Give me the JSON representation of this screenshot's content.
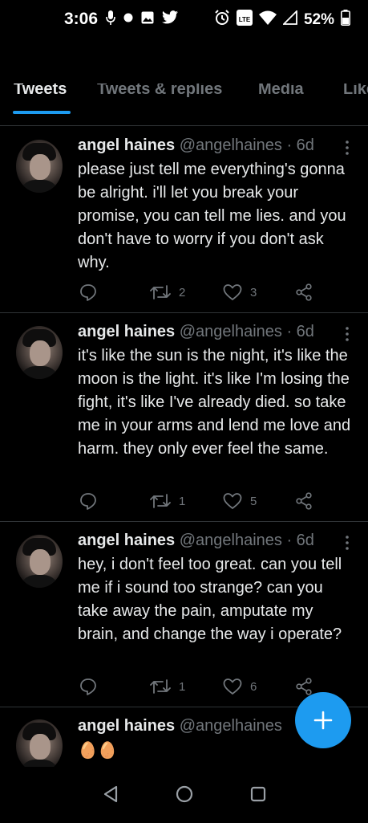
{
  "status_bar": {
    "time": "3:06",
    "battery": "52%",
    "lte_label": "LTE"
  },
  "tabs": [
    {
      "label": "Tweets",
      "active": true
    },
    {
      "label": "Tweets & replies",
      "active": false
    },
    {
      "label": "Media",
      "active": false
    },
    {
      "label": "Likes",
      "active": false
    }
  ],
  "tweets": [
    {
      "name": "angel haines",
      "handle": "@angelhaines",
      "time": "· 6d",
      "text": "please just tell me everything's gonna be alright. i'll let you break your promise, you can tell me lies. and you don't have to worry if you don't ask why.",
      "retweets": "2",
      "likes": "3"
    },
    {
      "name": "angel haines",
      "handle": "@angelhaines",
      "time": "· 6d",
      "text": "it's like the sun is the night, it's like the moon is the light. it's like I'm losing the fight, it's like I've already died. so take me in your arms and lend me love and harm. they only ever feel the same.",
      "retweets": "1",
      "likes": "5"
    },
    {
      "name": "angel haines",
      "handle": "@angelhaines",
      "time": "· 6d",
      "text": "hey, i don't feel too great. can you tell me if i sound too strange? can you take away the pain, amputate my brain, and change the way i operate?",
      "retweets": "1",
      "likes": "6"
    },
    {
      "name": "angel haines",
      "handle": "@angelhaines",
      "time": "",
      "text": "🥚🥚"
    }
  ],
  "colors": {
    "accent": "#1d9bf0",
    "muted": "#71767b",
    "text": "#e7e9ea",
    "background": "#000000"
  },
  "icons": {
    "back": "arrow-left-icon",
    "search": "search-icon",
    "more": "more-vertical-icon",
    "reply": "reply-icon",
    "retweet": "retweet-icon",
    "like": "heart-icon",
    "share": "share-icon",
    "compose": "plus-icon"
  }
}
